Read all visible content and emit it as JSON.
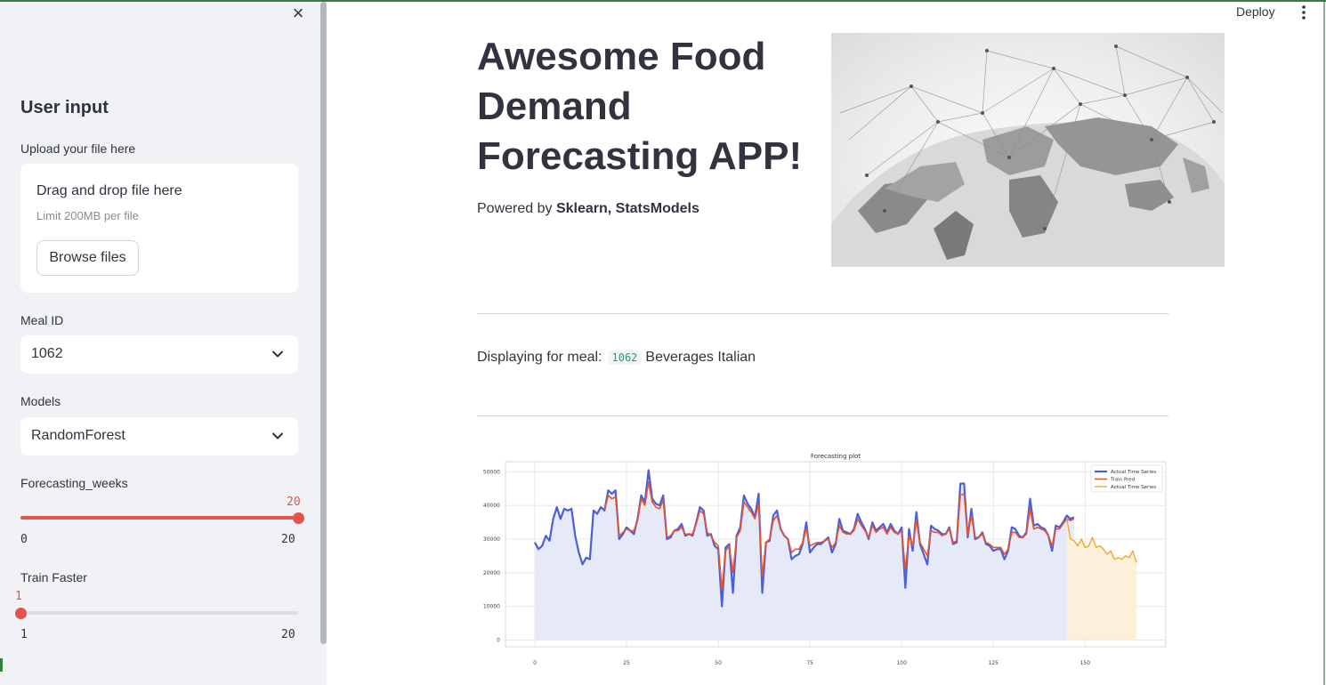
{
  "header": {
    "deploy_label": "Deploy",
    "menu_icon": "kebab-menu-icon"
  },
  "sidebar": {
    "close_icon": "×",
    "title": "User input",
    "upload": {
      "label": "Upload your file here",
      "dropzone_title": "Drag and drop file here",
      "limit_text": "Limit 200MB per file",
      "browse_label": "Browse files"
    },
    "meal_id": {
      "label": "Meal ID",
      "value": "1062"
    },
    "models": {
      "label": "Models",
      "value": "RandomForest"
    },
    "forecasting_weeks": {
      "label": "Forecasting_weeks",
      "value": "20",
      "min": "0",
      "max": "20",
      "fill_fraction": 1.0
    },
    "train_faster": {
      "label": "Train Faster",
      "value": "1",
      "min": "1",
      "max": "20",
      "fill_fraction": 0.0
    }
  },
  "main": {
    "title": "Awesome Food Demand Forecasting APP!",
    "powered_prefix": "Powered by ",
    "powered_libs": "Sklearn, StatsModels",
    "display_prefix": "Displaying for meal:",
    "meal_code": "1062",
    "meal_desc": "Beverages Italian"
  },
  "colors": {
    "accent": "#e5534b",
    "actual": "#4a5fd8",
    "train": "#e6552d",
    "forecast": "#f5a623"
  },
  "chart_data": {
    "type": "line",
    "title": "Forecasting plot",
    "xlabel": "",
    "ylabel": "",
    "xlim": [
      -8,
      172
    ],
    "ylim": [
      -2000,
      53000
    ],
    "xticks": [
      0,
      25,
      50,
      75,
      100,
      125,
      150
    ],
    "yticks": [
      0,
      10000,
      20000,
      30000,
      40000,
      50000
    ],
    "grid": true,
    "legend": "top-right",
    "series": [
      {
        "name": "Actual Time Series",
        "x_start": 0,
        "values": [
          29000,
          27000,
          28000,
          31000,
          29500,
          36000,
          39500,
          36000,
          39000,
          38500,
          39000,
          31000,
          26000,
          22500,
          24500,
          24000,
          38500,
          37500,
          39500,
          38500,
          44500,
          43500,
          44500,
          30000,
          31500,
          33500,
          32500,
          31500,
          36000,
          43000,
          41000,
          50500,
          42000,
          40500,
          40000,
          43000,
          30000,
          30500,
          32500,
          33000,
          34500,
          31000,
          31500,
          31000,
          35000,
          39500,
          38500,
          31000,
          31500,
          28000,
          27000,
          10000,
          27500,
          28500,
          14000,
          31000,
          33500,
          43000,
          40500,
          39000,
          36500,
          43500,
          14000,
          29000,
          29500,
          37000,
          38500,
          33000,
          31000,
          30000,
          24000,
          25000,
          25500,
          28500,
          35000,
          26000,
          27500,
          28500,
          28500,
          29500,
          30500,
          26000,
          28500,
          36000,
          32500,
          32000,
          31500,
          33000,
          37500,
          35000,
          33000,
          30000,
          35000,
          32500,
          33500,
          34500,
          32000,
          34500,
          32500,
          31500,
          33500,
          15500,
          33000,
          26500,
          38000,
          28500,
          25500,
          22500,
          34000,
          33000,
          32500,
          31500,
          31500,
          33500,
          28500,
          29000,
          46500,
          46500,
          30500,
          39000,
          30000,
          30500,
          32000,
          28500,
          28000,
          26500,
          27000,
          27000,
          24000,
          26500,
          33500,
          33000,
          31000,
          30500,
          32000,
          42000,
          34000,
          34500,
          33500,
          33000,
          31000,
          26500,
          34000,
          33500,
          35000,
          37000,
          36000,
          36500
        ]
      },
      {
        "name": "Train Pred",
        "x_start": 0,
        "values": [
          null,
          null,
          null,
          null,
          null,
          null,
          null,
          null,
          null,
          null,
          null,
          null,
          null,
          null,
          null,
          null,
          null,
          null,
          null,
          38500,
          43000,
          42000,
          42500,
          31000,
          32000,
          33000,
          32500,
          32500,
          35500,
          42000,
          40000,
          47000,
          41000,
          39500,
          39000,
          41500,
          30500,
          31000,
          32500,
          32500,
          33500,
          31500,
          31500,
          31500,
          34500,
          38500,
          37500,
          32000,
          31000,
          29000,
          28000,
          15000,
          26500,
          28000,
          20000,
          30500,
          32500,
          41000,
          39500,
          38000,
          36000,
          40500,
          19000,
          29000,
          30000,
          35500,
          37000,
          33000,
          31000,
          30000,
          26000,
          27000,
          27000,
          29000,
          33000,
          28000,
          28500,
          29000,
          29000,
          29500,
          30000,
          27500,
          29000,
          34000,
          32000,
          31500,
          31500,
          32500,
          36000,
          34000,
          32500,
          30500,
          34000,
          32000,
          33000,
          33500,
          31500,
          33500,
          32000,
          31500,
          32500,
          21000,
          31000,
          28000,
          35500,
          29000,
          27000,
          25000,
          32500,
          32000,
          32000,
          31000,
          31500,
          33000,
          29000,
          29500,
          43000,
          43500,
          31000,
          37000,
          30500,
          30500,
          31500,
          29000,
          28500,
          27500,
          27500,
          27500,
          25500,
          27000,
          32000,
          32000,
          30500,
          30500,
          31500,
          39000,
          33000,
          33500,
          33000,
          32500,
          31000,
          28000,
          33000,
          33000,
          34500,
          36000,
          35500,
          36000
        ]
      },
      {
        "name": "Actual Time Series",
        "x_start": 145,
        "values": [
          36000,
          30000,
          29500,
          28000,
          30000,
          27500,
          28000,
          30500,
          27500,
          28000,
          27000,
          25500,
          26500,
          24000,
          24500,
          24000,
          25000,
          24500,
          26500,
          23000
        ]
      }
    ]
  }
}
